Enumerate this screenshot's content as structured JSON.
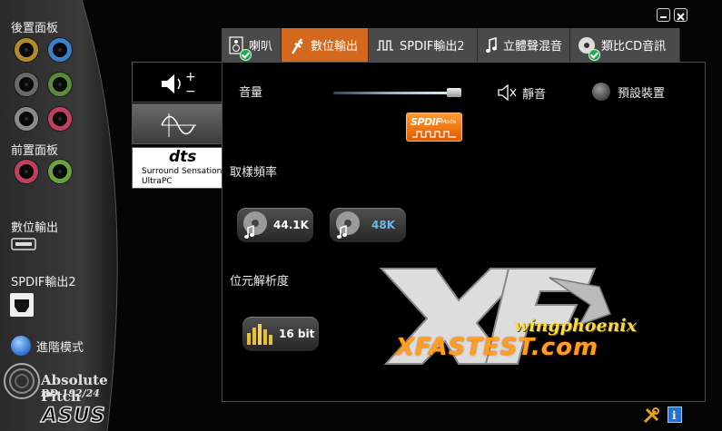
{
  "window": {
    "minimize_icon": "minimize-icon",
    "close_icon": "close-icon"
  },
  "left_panel": {
    "rear_panel_label": "後置面板",
    "front_panel_label": "前置面板",
    "digital_output_label": "數位輸出",
    "spdif2_label": "SPDIF輸出2",
    "advanced_mode_label": "進階模式",
    "rear_jack_colors": [
      "#b08a2a",
      "#3a7fc8",
      "#6a6a6a",
      "#5a8a3a",
      "#8a8a8a",
      "#c04060"
    ],
    "front_jack_colors": [
      "#c04060",
      "#6aa040"
    ]
  },
  "tabs": [
    {
      "label": "喇叭",
      "icon": "speaker-icon",
      "active": false,
      "checked": true
    },
    {
      "label": "數位輸出",
      "icon": "plug-icon",
      "active": true,
      "checked": false
    },
    {
      "label": "SPDIF輸出2",
      "icon": "pulse-wave-icon",
      "active": false,
      "checked": false
    },
    {
      "label": "立體聲混音",
      "icon": "music-note-icon",
      "active": false,
      "checked": false
    },
    {
      "label": "類比CD音訊",
      "icon": "cd-icon",
      "active": false,
      "checked": true
    }
  ],
  "effects": [
    {
      "name": "volume-plus-minus",
      "icon": "volume-plus-minus-icon"
    },
    {
      "name": "waveform",
      "icon": "sine-wave-icon"
    },
    {
      "name": "dts",
      "logo_text": "dts",
      "line1": "Surround Sensation",
      "line2": "UltraPC"
    }
  ],
  "main": {
    "volume_label": "音量",
    "volume_level": 0.95,
    "mute_label": "靜音",
    "default_device_label": "預設裝置",
    "spdif_badge_text": "SPDIF",
    "spdif_badge_sub": "Mode",
    "sample_rate_label": "取樣頻率",
    "sample_rates": [
      "44.1K",
      "48K"
    ],
    "sample_rate_selected": "48K",
    "bit_depth_label": "位元解析度",
    "bit_depth": "16 bit"
  },
  "watermark": {
    "top": "wingphoenix",
    "bottom": "XFASTEST.com",
    "logo": "XF"
  },
  "brand": {
    "line1": "Absolute Pitch",
    "line2": "BD 192/24",
    "logo": "ASUS"
  },
  "footer": {
    "tools_icon": "tools-icon",
    "info_icon": "info-icon"
  },
  "colors": {
    "active_tab": "#d2691e",
    "tab": "#4a4a4a",
    "accent_blue": "#6ab8e8"
  }
}
